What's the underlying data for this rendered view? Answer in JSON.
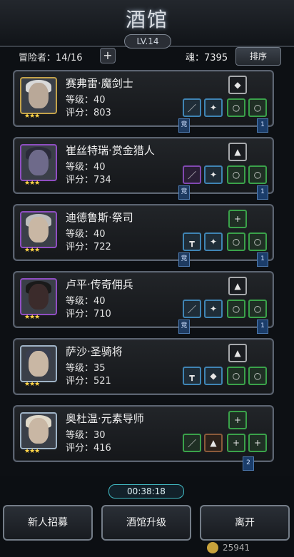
{
  "header": {
    "title": "酒馆",
    "level": "LV.14"
  },
  "info": {
    "adventurers_label": "冒险者：",
    "adventurers_count": "14/16",
    "add": "+",
    "soul_label": "魂：",
    "soul_value": "7395",
    "sort_label": "排序"
  },
  "cards": [
    {
      "name": "赛弗雷·魔剑士",
      "level": "等级：40",
      "score": "评分：803",
      "stars": "★★★",
      "tier": "gold",
      "ribbons": [
        "竞",
        "1"
      ]
    },
    {
      "name": "崔丝特瑞·赏金猎人",
      "level": "等级：40",
      "score": "评分：734",
      "stars": "★★★",
      "tier": "purple",
      "ribbons": [
        "竞",
        "1"
      ]
    },
    {
      "name": "迪德鲁斯·祭司",
      "level": "等级：40",
      "score": "评分：722",
      "stars": "★★★",
      "tier": "purple",
      "ribbons": [
        "竞",
        "1"
      ]
    },
    {
      "name": "卢平·传奇佣兵",
      "level": "等级：40",
      "score": "评分：710",
      "stars": "★★★",
      "tier": "purple",
      "ribbons": [
        "竞",
        "1"
      ]
    },
    {
      "name": "萨沙·圣骑将",
      "level": "等级：35",
      "score": "评分：521",
      "stars": "★★★",
      "tier": "silver",
      "ribbons": []
    },
    {
      "name": "奥杜温·元素导师",
      "level": "等级：30",
      "score": "评分：416",
      "stars": "★★★",
      "tier": "silver",
      "ribbons": [
        "2"
      ]
    }
  ],
  "timer": "00:38:18",
  "buttons": {
    "recruit": "新人招募",
    "upgrade": "酒馆升级",
    "leave": "离开"
  },
  "currency": "25941"
}
